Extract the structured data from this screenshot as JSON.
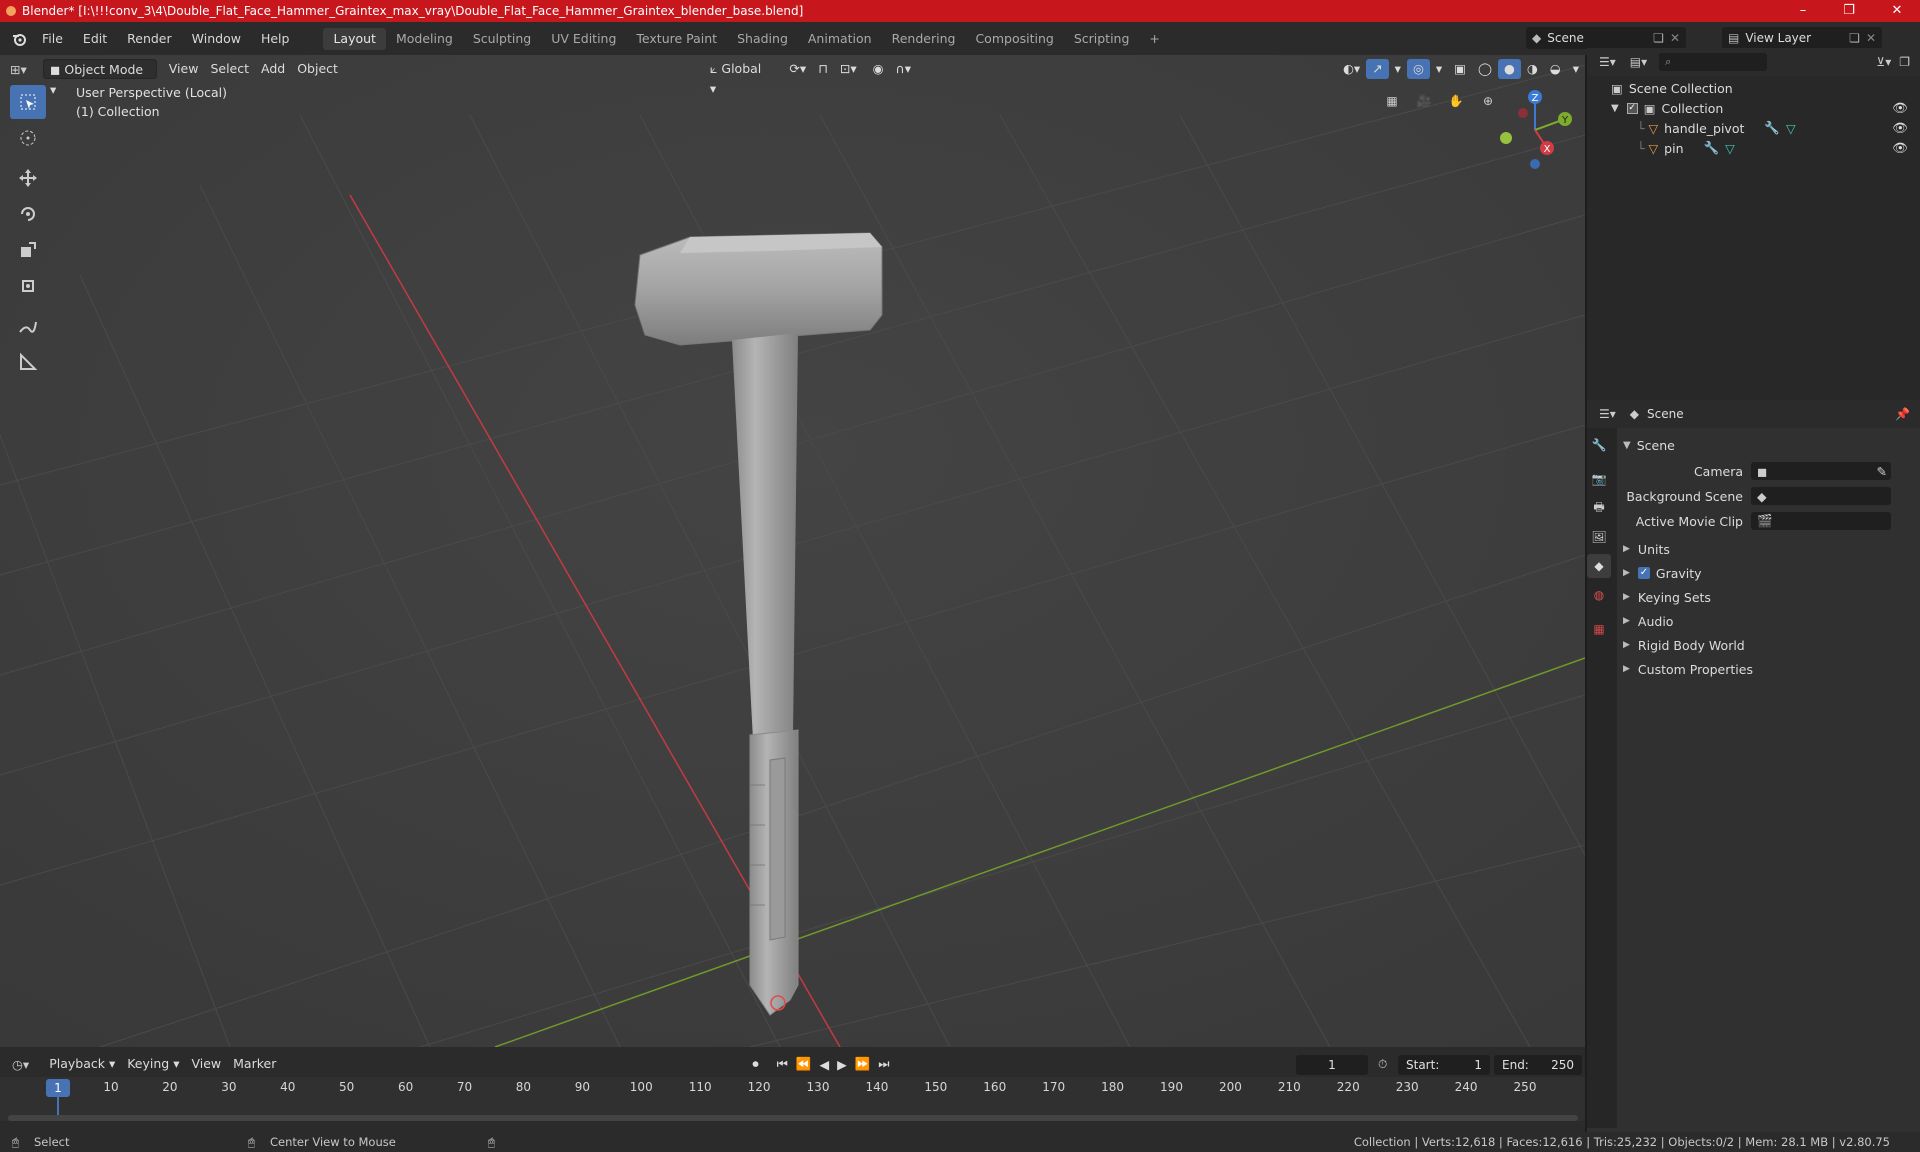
{
  "window": {
    "title": "Blender* [I:\\!!!conv_3\\4\\Double_Flat_Face_Hammer_Graintex_max_vray\\Double_Flat_Face_Hammer_Graintex_blender_base.blend]",
    "minimize": "–",
    "maximize": "❐",
    "close": "✕"
  },
  "menu": [
    "File",
    "Edit",
    "Render",
    "Window",
    "Help"
  ],
  "workspaces": [
    "Layout",
    "Modeling",
    "Sculpting",
    "UV Editing",
    "Texture Paint",
    "Shading",
    "Animation",
    "Rendering",
    "Compositing",
    "Scripting"
  ],
  "active_workspace": "Layout",
  "scene_selector": "Scene",
  "view_layer": "View Layer",
  "viewport": {
    "mode": "Object Mode",
    "menus": [
      "View",
      "Select",
      "Add",
      "Object"
    ],
    "orientation": "Global",
    "perspective_label": "User Perspective (Local)",
    "collection_label": "(1) Collection",
    "gizmo": {
      "x": "X",
      "y": "Y",
      "z": "Z"
    }
  },
  "outliner": {
    "root": "Scene Collection",
    "collection": "Collection",
    "items": [
      {
        "name": "handle_pivot"
      },
      {
        "name": "pin"
      }
    ]
  },
  "properties": {
    "header": "Scene",
    "panel_title": "Scene",
    "fields": [
      {
        "label": "Camera"
      },
      {
        "label": "Background Scene"
      },
      {
        "label": "Active Movie Clip"
      }
    ],
    "sections": [
      "Units",
      "Gravity",
      "Keying Sets",
      "Audio",
      "Rigid Body World",
      "Custom Properties"
    ],
    "gravity_checked": true
  },
  "timeline": {
    "menus": [
      "Playback",
      "Keying",
      "View",
      "Marker"
    ],
    "current_frame": "1",
    "start_label": "Start:",
    "start": "1",
    "end_label": "End:",
    "end": "250",
    "ticks": [
      "1",
      "10",
      "20",
      "30",
      "40",
      "50",
      "60",
      "70",
      "80",
      "90",
      "100",
      "110",
      "120",
      "130",
      "140",
      "150",
      "160",
      "170",
      "180",
      "190",
      "200",
      "210",
      "220",
      "230",
      "240",
      "250"
    ]
  },
  "status": {
    "left": "Select",
    "middle": "Center View to Mouse",
    "right": "Collection | Verts:12,618 | Faces:12,616 | Tris:25,232 | Objects:0/2 | Mem: 28.1 MB | v2.80.75"
  },
  "colors": {
    "title_bar": "#c8161d",
    "accent": "#4772b3",
    "x_axis": "#d23c46",
    "y_axis": "#7dab2c",
    "z_axis": "#3d7ad6"
  }
}
